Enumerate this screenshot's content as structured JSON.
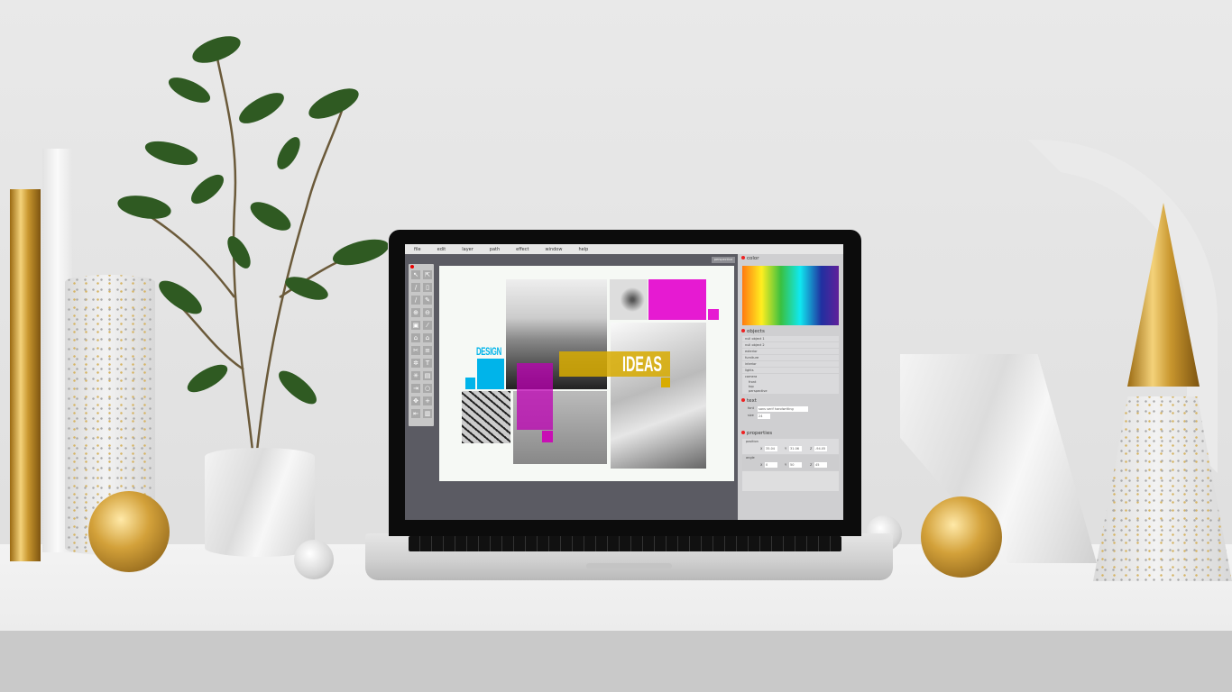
{
  "app": {
    "menu": [
      "file",
      "edit",
      "layer",
      "path",
      "effect",
      "window",
      "help"
    ],
    "view_button": "perspective",
    "tools": [
      "select-arrow",
      "direct-select",
      "pencil",
      "page",
      "brush",
      "pen",
      "zoom-in",
      "zoom-out",
      "lock",
      "wand",
      "home-outline",
      "home",
      "scissors",
      "layers",
      "settings",
      "text",
      "burst",
      "save",
      "export",
      "rotate",
      "move",
      "add",
      "exit",
      "trash"
    ],
    "canvas": {
      "title_left": "DESIGN",
      "title_right": "IDEAS",
      "colors": {
        "cyan": "#00b4ea",
        "magenta": "#e414c8",
        "yellow": "#d8ac00"
      }
    },
    "panel": {
      "color": {
        "title": "color"
      },
      "objects": {
        "title": "objects",
        "items": [
          "null object 1",
          "null object 2",
          "exterior",
          "furniture",
          "interior",
          "lights",
          "camera"
        ],
        "camera_children": [
          "front",
          "top",
          "perspective"
        ]
      },
      "text": {
        "title": "text",
        "font_label": "font",
        "font_value": "sans serif handwriting",
        "size_label": "size",
        "size_value": "24"
      },
      "properties": {
        "title": "properties",
        "position": {
          "label": "position",
          "x": "35.04",
          "y": "31.06",
          "z": "-94.05"
        },
        "angle": {
          "label": "angle",
          "x": "0",
          "y": "50",
          "z": "45"
        },
        "axes": [
          "X",
          "Y",
          "Z"
        ]
      }
    }
  }
}
